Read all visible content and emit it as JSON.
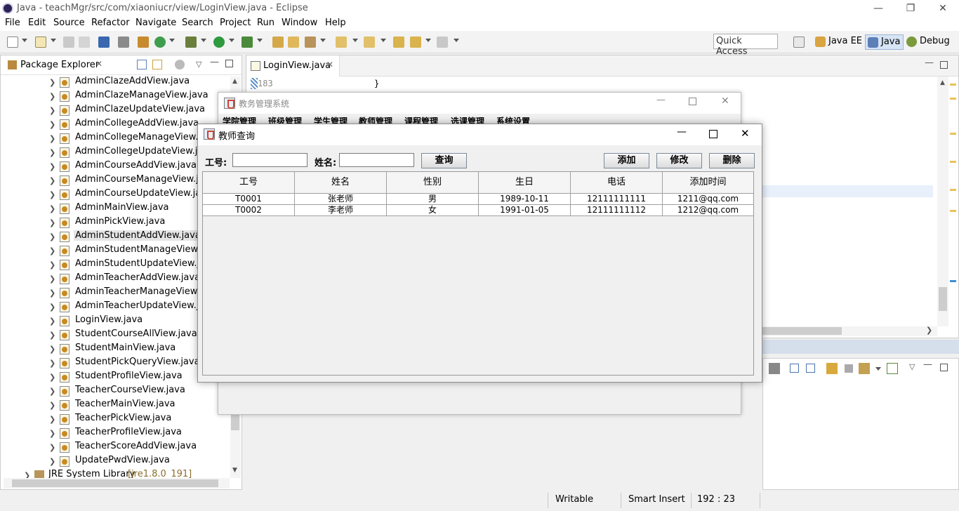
{
  "window": {
    "title": "Java - teachMgr/src/com/xiaoniucr/view/LoginView.java - Eclipse"
  },
  "menubar": [
    "File",
    "Edit",
    "Source",
    "Refactor",
    "Navigate",
    "Search",
    "Project",
    "Run",
    "Window",
    "Help"
  ],
  "toolbar": {
    "quick_access": "Quick Access",
    "perspectives": [
      "Java EE",
      "Java",
      "Debug"
    ]
  },
  "package_explorer": {
    "title": "Package Explorer",
    "files": [
      "AdminClazeAddView.java",
      "AdminClazeManageView.java",
      "AdminClazeUpdateView.java",
      "AdminCollegeAddView.java",
      "AdminCollegeManageView.jav",
      "AdminCollegeUpdateView.java",
      "AdminCourseAddView.java",
      "AdminCourseManageView.java",
      "AdminCourseUpdateView.java",
      "AdminMainView.java",
      "AdminPickView.java",
      "AdminStudentAddView.java",
      "AdminStudentManageView.jav",
      "AdminStudentUpdateView.java",
      "AdminTeacherAddView.java",
      "AdminTeacherManageView.jav",
      "AdminTeacherUpdateView.java",
      "LoginView.java",
      "StudentCourseAllView.java",
      "StudentMainView.java",
      "StudentPickQueryView.java",
      "StudentProfileView.java",
      "TeacherCourseView.java",
      "TeacherMainView.java",
      "TeacherPickView.java",
      "TeacherProfileView.java",
      "TeacherScoreAddView.java",
      "UpdatePwdView.java"
    ],
    "selected_index": 11,
    "jre": "JRE System Library",
    "jre_version": "[jre1.8.0_191]"
  },
  "editor": {
    "tab": "LoginView.java",
    "line_number": "183",
    "line_code": "}"
  },
  "status": {
    "writable": "Writable",
    "insert_mode": "Smart Insert",
    "position": "192 : 23"
  },
  "back_frame": {
    "title": "教务管理系统",
    "menus": [
      "学院管理",
      "班级管理",
      "学生管理",
      "教师管理",
      "课程管理",
      "选课管理",
      "系统设置"
    ]
  },
  "dialog": {
    "title": "教师查询",
    "id_label": "工号:",
    "name_label": "姓名:",
    "id_value": "",
    "name_value": "",
    "query_button": "查询",
    "add_button": "添加",
    "edit_button": "修改",
    "delete_button": "删除",
    "columns": [
      "工号",
      "姓名",
      "性别",
      "生日",
      "电话",
      "添加时间"
    ],
    "rows": [
      [
        "T0001",
        "张老师",
        "男",
        "1989-10-11",
        "12111111111",
        "1211@qq.com"
      ],
      [
        "T0002",
        "李老师",
        "女",
        "1991-01-05",
        "12111111112",
        "1212@qq.com"
      ]
    ]
  }
}
